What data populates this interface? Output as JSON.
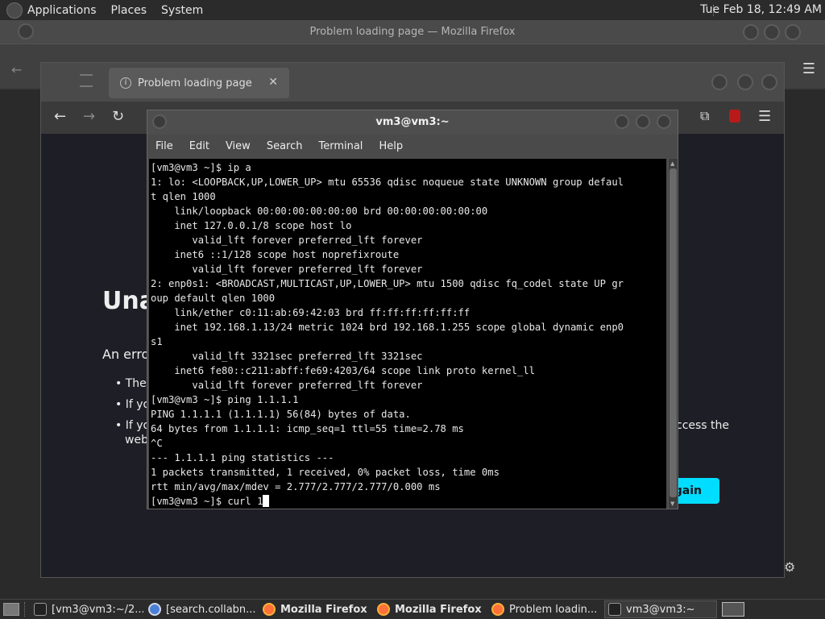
{
  "top_panel": {
    "menus": [
      "Applications",
      "Places",
      "System"
    ],
    "clock": "Tue Feb 18, 12:49 AM"
  },
  "outer_window": {
    "title": "Problem loading page — Mozilla Firefox"
  },
  "firefox": {
    "tab_title": "Problem loading page",
    "page": {
      "title_partial": "Una",
      "error_partial": "An erro",
      "bullets_partial": [
        "The",
        "If yo",
        "If yo",
        "web"
      ],
      "right_text_partial": "ccess the",
      "try_again_partial": "gain"
    }
  },
  "terminal": {
    "title": "vm3@vm3:~",
    "menu": [
      "File",
      "Edit",
      "View",
      "Search",
      "Terminal",
      "Help"
    ],
    "lines": [
      "[vm3@vm3 ~]$ ip a",
      "1: lo: <LOOPBACK,UP,LOWER_UP> mtu 65536 qdisc noqueue state UNKNOWN group defaul",
      "t qlen 1000",
      "    link/loopback 00:00:00:00:00:00 brd 00:00:00:00:00:00",
      "    inet 127.0.0.1/8 scope host lo",
      "       valid_lft forever preferred_lft forever",
      "    inet6 ::1/128 scope host noprefixroute",
      "       valid_lft forever preferred_lft forever",
      "2: enp0s1: <BROADCAST,MULTICAST,UP,LOWER_UP> mtu 1500 qdisc fq_codel state UP gr",
      "oup default qlen 1000",
      "    link/ether c0:11:ab:69:42:03 brd ff:ff:ff:ff:ff:ff",
      "    inet 192.168.1.13/24 metric 1024 brd 192.168.1.255 scope global dynamic enp0",
      "s1",
      "       valid_lft 3321sec preferred_lft 3321sec",
      "    inet6 fe80::c211:abff:fe69:4203/64 scope link proto kernel_ll",
      "       valid_lft forever preferred_lft forever",
      "[vm3@vm3 ~]$ ping 1.1.1.1",
      "PING 1.1.1.1 (1.1.1.1) 56(84) bytes of data.",
      "64 bytes from 1.1.1.1: icmp_seq=1 ttl=55 time=2.78 ms",
      "^C",
      "--- 1.1.1.1 ping statistics ---",
      "1 packets transmitted, 1 received, 0% packet loss, time 0ms",
      "rtt min/avg/max/mdev = 2.777/2.777/2.777/0.000 ms"
    ],
    "current_input": "[vm3@vm3 ~]$ curl 1"
  },
  "taskbar": {
    "tasks": [
      {
        "label": "[vm3@vm3:~/2...",
        "icon": "terminal-icon"
      },
      {
        "label": "[search.collabn...",
        "icon": "chrome-icon"
      },
      {
        "label": "Mozilla Firefox",
        "icon": "firefox-icon"
      },
      {
        "label": "Mozilla Firefox",
        "icon": "firefox-icon"
      },
      {
        "label": "Problem loadin...",
        "icon": "firefox-icon"
      },
      {
        "label": "vm3@vm3:~",
        "icon": "terminal-icon"
      }
    ]
  },
  "colors": {
    "panel": "#2b2b2b",
    "terminal_bg": "#000000",
    "terminal_fg": "#e8e8e8",
    "accent_button": "#00ddff",
    "page_bg": "#1e1e26"
  }
}
